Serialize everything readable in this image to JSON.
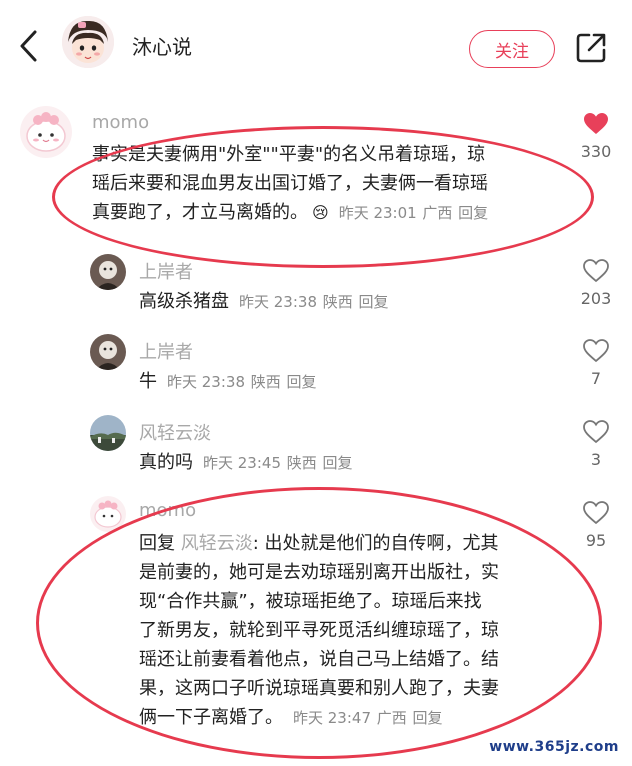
{
  "header": {
    "user_name": "沐心说",
    "follow_label": "关注"
  },
  "colors": {
    "accent": "#e8405a",
    "like_active": "#e8405a",
    "annotation": "#e63a4e"
  },
  "comments": [
    {
      "username": "momo",
      "lines": [
        "事实是夫妻俩用\"外室\"\"平妻\"的名义吊着琼瑶，琼",
        "瑶后来要和混血男友出国订婚了，夫妻俩一看琼瑶",
        "真要跑了，才立马离婚的。"
      ],
      "emoji": "😢",
      "time": "昨天 23:01",
      "location": "广西",
      "reply_label": "回复",
      "likes": "330",
      "liked": true
    }
  ],
  "replies": [
    {
      "username": "上岸者",
      "text": "高级杀猪盘",
      "time": "昨天 23:38",
      "location": "陕西",
      "reply_label": "回复",
      "likes": "203"
    },
    {
      "username": "上岸者",
      "text": "牛",
      "time": "昨天 23:38",
      "location": "陕西",
      "reply_label": "回复",
      "likes": "7"
    },
    {
      "username": "风轻云淡",
      "text": "真的吗",
      "time": "昨天 23:45",
      "location": "陕西",
      "reply_label": "回复",
      "likes": "3"
    },
    {
      "username": "momo",
      "reply_prefix": "回复",
      "reply_target": "风轻云淡",
      "first_line_rest": ": 出处就是他们的自传啊，尤其",
      "lines": [
        "是前妻的，她可是去劝琼瑶别离开出版社，实",
        "现“合作共赢”，被琼瑶拒绝了。琼瑶后来找",
        "了新男友，就轮到平寻死觅活纠缠琼瑶了，琼",
        "瑶还让前妻看着他点，说自己马上结婚了。结",
        "果，这两口子听说琼瑶真要和别人跑了，夫妻",
        "俩一下子离婚了。"
      ],
      "time": "昨天 23:47",
      "location": "广西",
      "reply_label": "回复",
      "likes": "95"
    }
  ],
  "watermark": "www.365jz.com"
}
